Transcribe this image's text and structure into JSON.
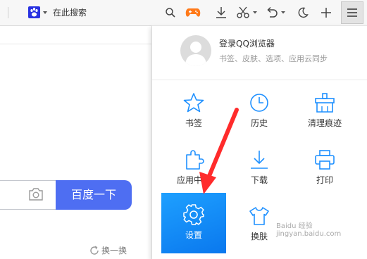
{
  "toolbar": {
    "search_text": "在此搜索",
    "icons": [
      "baidu-paw-icon",
      "chevron-down-icon",
      "search-icon",
      "game-controller-icon",
      "download-icon",
      "scissors-icon",
      "undo-icon",
      "moon-icon",
      "plus-icon",
      "menu-icon"
    ]
  },
  "page": {
    "search_button": "百度一下",
    "refresh_label": "换一换"
  },
  "menu": {
    "login_title": "登录QQ浏览器",
    "login_subtitle": "书签、皮肤、选项、应用云同步",
    "items": [
      {
        "label": "书签",
        "icon": "star-icon"
      },
      {
        "label": "历史",
        "icon": "clock-icon"
      },
      {
        "label": "清理痕迹",
        "icon": "broom-icon"
      },
      {
        "label": "应用中心",
        "icon": "puzzle-icon"
      },
      {
        "label": "下载",
        "icon": "download-icon"
      },
      {
        "label": "打印",
        "icon": "printer-icon"
      },
      {
        "label": "设置",
        "icon": "gear-icon"
      },
      {
        "label": "换肤",
        "icon": "tshirt-icon"
      }
    ]
  },
  "colors": {
    "accent": "#1e90ff",
    "baidu_blue": "#4e6ef2",
    "annotation_red": "#ff2b2b",
    "game_orange": "#ff7a1a"
  },
  "watermark": "Baidu 经验 jingyan.baidu.com"
}
